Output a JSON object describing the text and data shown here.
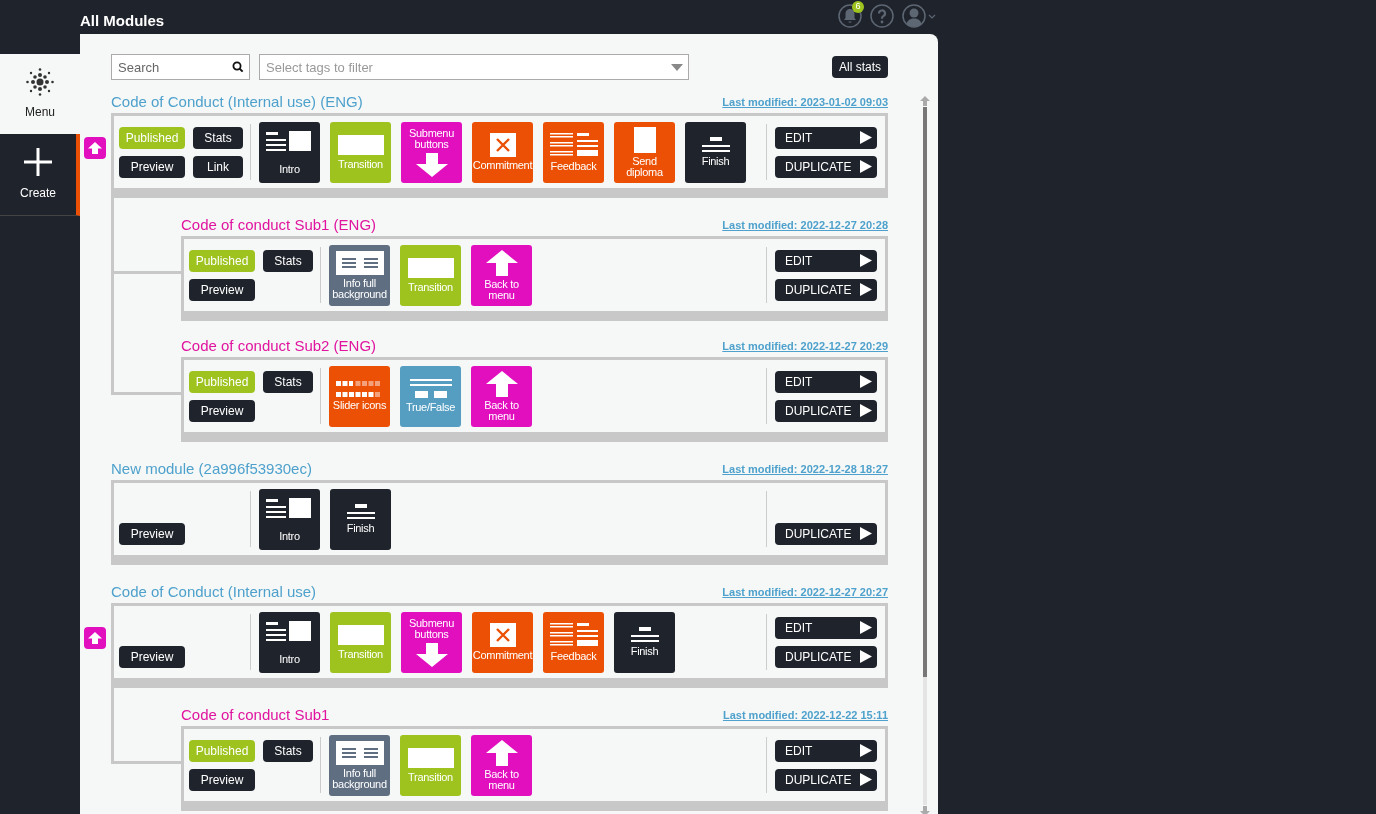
{
  "header": {
    "title": "All Modules",
    "notification_count": "6"
  },
  "sidebar": {
    "items": [
      {
        "kind": "menu",
        "label": "Menu"
      },
      {
        "kind": "create",
        "label": "Create"
      }
    ]
  },
  "toolbar": {
    "search_placeholder": "Search",
    "tags_placeholder": "Select tags to filter",
    "all_stats": "All stats"
  },
  "modules": [
    {
      "title": "Code of Conduct (Internal use) (ENG)",
      "modified": "Last modified: 2023-01-02 09:03",
      "buttons": [
        {
          "kind": "published",
          "label": "Published"
        },
        {
          "kind": "stats",
          "label": "Stats"
        },
        {
          "kind": "preview",
          "label": "Preview"
        },
        {
          "kind": "link",
          "label": "Link"
        }
      ],
      "slides": [
        {
          "kind": "intro",
          "label": "Intro"
        },
        {
          "kind": "transition",
          "label": "Transition"
        },
        {
          "kind": "submenu",
          "label": "Submenu buttons"
        },
        {
          "kind": "commitment",
          "label": "Commitment"
        },
        {
          "kind": "feedback",
          "label": "Feedback"
        },
        {
          "kind": "diploma",
          "label": "Send diploma"
        },
        {
          "kind": "finish",
          "label": "Finish"
        }
      ],
      "actions": [
        {
          "kind": "edit",
          "label": "EDIT"
        },
        {
          "kind": "duplicate",
          "label": "DUPLICATE"
        }
      ],
      "children": [
        {
          "title": "Code of conduct Sub1 (ENG)",
          "modified": "Last modified: 2022-12-27 20:28",
          "buttons": [
            {
              "kind": "published",
              "label": "Published"
            },
            {
              "kind": "stats",
              "label": "Stats"
            },
            {
              "kind": "preview",
              "label": "Preview"
            }
          ],
          "slides": [
            {
              "kind": "info",
              "label": "Info full background"
            },
            {
              "kind": "transition",
              "label": "Transition"
            },
            {
              "kind": "back",
              "label": "Back to menu"
            }
          ],
          "actions": [
            {
              "kind": "edit",
              "label": "EDIT"
            },
            {
              "kind": "duplicate",
              "label": "DUPLICATE"
            }
          ]
        },
        {
          "title": "Code of conduct Sub2 (ENG)",
          "modified": "Last modified: 2022-12-27 20:29",
          "buttons": [
            {
              "kind": "published",
              "label": "Published"
            },
            {
              "kind": "stats",
              "label": "Stats"
            },
            {
              "kind": "preview",
              "label": "Preview"
            }
          ],
          "slides": [
            {
              "kind": "slider",
              "label": "Slider icons"
            },
            {
              "kind": "truefalse",
              "label": "True/False"
            },
            {
              "kind": "back",
              "label": "Back to menu"
            }
          ],
          "actions": [
            {
              "kind": "edit",
              "label": "EDIT"
            },
            {
              "kind": "duplicate",
              "label": "DUPLICATE"
            }
          ]
        }
      ]
    },
    {
      "title": "New module (2a996f53930ec)",
      "modified": "Last modified: 2022-12-28 18:27",
      "buttons": [
        {
          "kind": "preview",
          "label": "Preview"
        }
      ],
      "slides": [
        {
          "kind": "intro",
          "label": "Intro"
        },
        {
          "kind": "finish",
          "label": "Finish"
        }
      ],
      "actions": [
        {
          "kind": "duplicate",
          "label": "DUPLICATE"
        }
      ]
    },
    {
      "title": "Code of Conduct (Internal use)",
      "modified": "Last modified: 2022-12-27 20:27",
      "buttons": [
        {
          "kind": "preview",
          "label": "Preview"
        }
      ],
      "slides": [
        {
          "kind": "intro",
          "label": "Intro"
        },
        {
          "kind": "transition",
          "label": "Transition"
        },
        {
          "kind": "submenu",
          "label": "Submenu buttons"
        },
        {
          "kind": "commitment",
          "label": "Commitment"
        },
        {
          "kind": "feedback",
          "label": "Feedback"
        },
        {
          "kind": "finish",
          "label": "Finish"
        }
      ],
      "actions": [
        {
          "kind": "edit",
          "label": "EDIT"
        },
        {
          "kind": "duplicate",
          "label": "DUPLICATE"
        }
      ],
      "children": [
        {
          "title": "Code of conduct Sub1",
          "modified": "Last modified: 2022-12-22 15:11",
          "buttons": [
            {
              "kind": "published",
              "label": "Published"
            },
            {
              "kind": "stats",
              "label": "Stats"
            },
            {
              "kind": "preview",
              "label": "Preview"
            }
          ],
          "slides": [
            {
              "kind": "info",
              "label": "Info full background"
            },
            {
              "kind": "transition",
              "label": "Transition"
            },
            {
              "kind": "back",
              "label": "Back to menu"
            }
          ],
          "actions": [
            {
              "kind": "edit",
              "label": "EDIT"
            },
            {
              "kind": "duplicate",
              "label": "DUPLICATE"
            }
          ]
        }
      ]
    }
  ]
}
